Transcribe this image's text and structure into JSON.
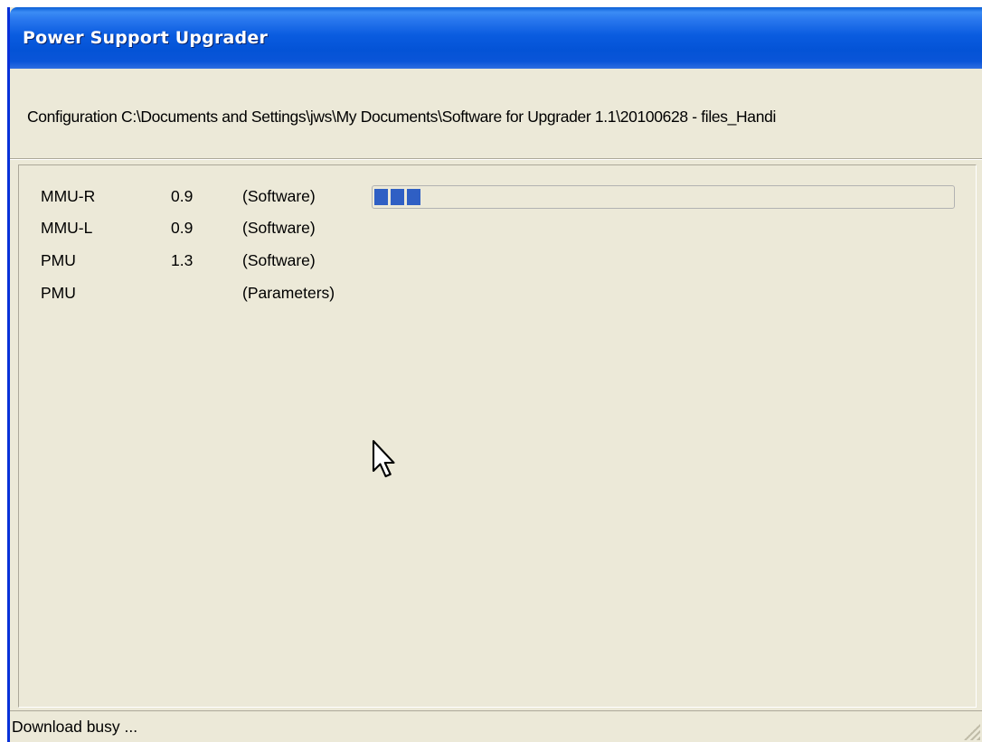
{
  "window": {
    "title": "Power Support Upgrader"
  },
  "config": {
    "text": "Configuration C:\\Documents and Settings\\jws\\My Documents\\Software for Upgrader 1.1\\20100628 - files_Handi"
  },
  "items": [
    {
      "name": "MMU-R",
      "version": "0.9",
      "type": "(Software)"
    },
    {
      "name": "MMU-L",
      "version": "0.9",
      "type": "(Software)"
    },
    {
      "name": "PMU",
      "version": "1.3",
      "type": "(Software)"
    },
    {
      "name": "PMU",
      "version": "",
      "type": "(Parameters)"
    }
  ],
  "progress": {
    "fraction": 0.085,
    "fill_color": "#2f5fc4"
  },
  "status": {
    "text": "Download busy ..."
  },
  "icons": {
    "resize": "resize-grip-icon",
    "pointer": "mouse-pointer-icon"
  }
}
